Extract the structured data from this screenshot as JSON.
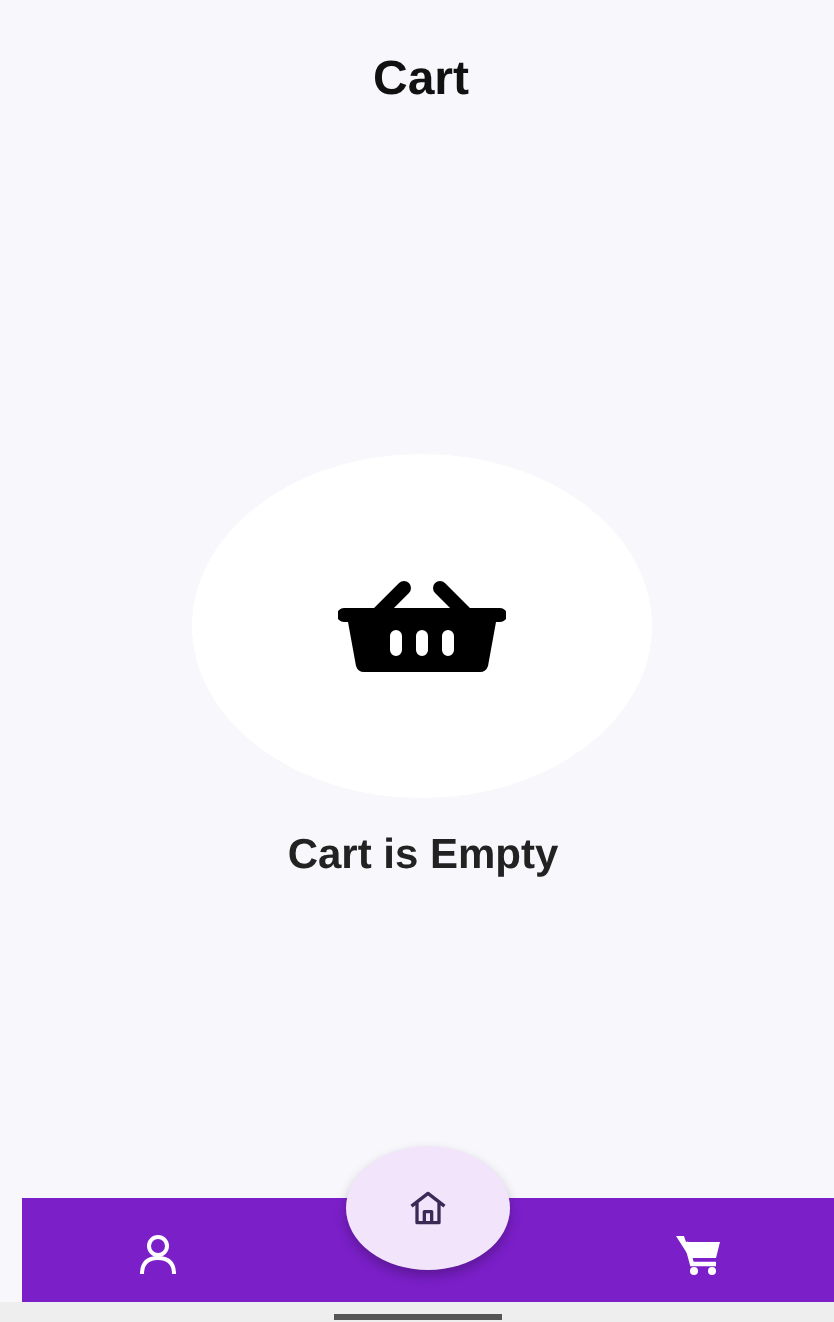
{
  "header": {
    "title": "Cart"
  },
  "empty_state": {
    "message": "Cart is Empty"
  },
  "bottom_nav": [
    {
      "kind": "profile"
    },
    {
      "kind": "home"
    },
    {
      "kind": "cart"
    }
  ]
}
